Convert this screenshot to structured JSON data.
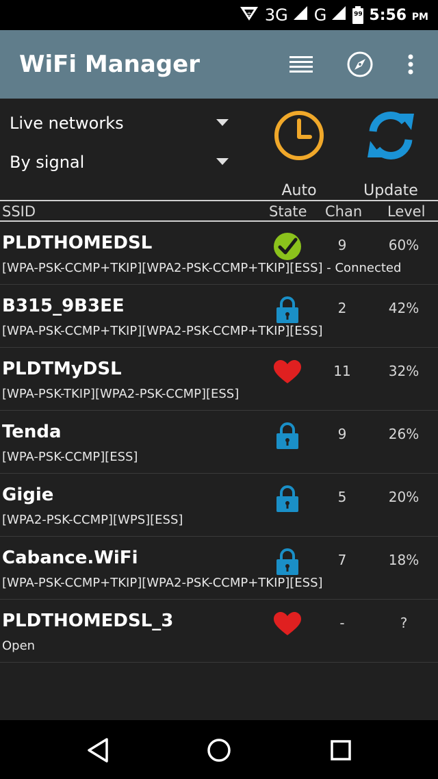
{
  "status_bar": {
    "network_type": "3G",
    "network_type_2": "G",
    "battery": "99",
    "time": "5:56",
    "time_suffix": "PM"
  },
  "app": {
    "title": "WiFi Manager",
    "actions": [
      "list-icon",
      "compass-icon",
      "overflow-menu-icon"
    ]
  },
  "controls": {
    "source_dropdown": "Live networks",
    "sort_dropdown": "By signal",
    "auto_label": "Auto",
    "update_label": "Update",
    "auto_color": "#f0a82a",
    "update_color": "#1a93d6"
  },
  "table": {
    "headers": {
      "ssid": "SSID",
      "state": "State",
      "chan": "Chan",
      "level": "Level"
    },
    "rows": [
      {
        "ssid": "PLDTHOMEDSL",
        "caps": "[WPA-PSK-CCMP+TKIP][WPA2-PSK-CCMP+TKIP][ESS] - Connected",
        "state": "connected-check-icon",
        "chan": "9",
        "level": "60%"
      },
      {
        "ssid": "B315_9B3EE",
        "caps": "[WPA-PSK-CCMP+TKIP][WPA2-PSK-CCMP+TKIP][ESS]",
        "state": "lock-icon",
        "chan": "2",
        "level": "42%"
      },
      {
        "ssid": "PLDTMyDSL",
        "caps": "[WPA-PSK-TKIP][WPA2-PSK-CCMP][ESS]",
        "state": "heart-icon",
        "chan": "11",
        "level": "32%"
      },
      {
        "ssid": "Tenda",
        "caps": "[WPA-PSK-CCMP][ESS]",
        "state": "lock-icon",
        "chan": "9",
        "level": "26%"
      },
      {
        "ssid": "Gigie",
        "caps": "[WPA2-PSK-CCMP][WPS][ESS]",
        "state": "lock-icon",
        "chan": "5",
        "level": "20%"
      },
      {
        "ssid": "Cabance.WiFi",
        "caps": "[WPA-PSK-CCMP+TKIP][WPA2-PSK-CCMP+TKIP][ESS]",
        "state": "lock-icon",
        "chan": "7",
        "level": "18%"
      },
      {
        "ssid": "PLDTHOMEDSL_3",
        "caps": "Open",
        "state": "heart-icon",
        "chan": "-",
        "level": "?"
      }
    ]
  },
  "colors": {
    "appbar": "#607d8b",
    "lock": "#1a8fc7",
    "heart": "#e02020",
    "check": "#8bc21c"
  },
  "nav": [
    "back-icon",
    "home-icon",
    "recents-icon"
  ]
}
